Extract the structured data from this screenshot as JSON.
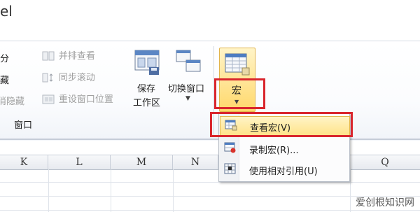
{
  "window": {
    "title_fragment": "el"
  },
  "ribbon": {
    "window_group": {
      "left_partial": [
        "分",
        "藏",
        "消隐藏"
      ],
      "items": [
        {
          "label": "并排查看",
          "enabled": false
        },
        {
          "label": "同步滚动",
          "enabled": false
        },
        {
          "label": "重设窗口位置",
          "enabled": false
        }
      ],
      "save_workspace_label_line1": "保存",
      "save_workspace_label_line2": "工作区",
      "switch_windows_label": "切换窗口",
      "group_label": "窗口"
    },
    "macros_group": {
      "label": "宏"
    }
  },
  "sheet": {
    "columns": [
      "K",
      "L",
      "M",
      "N",
      "Q"
    ]
  },
  "macro_menu": {
    "items": [
      {
        "label": "查看宏(V)",
        "icon": "view-macros-icon",
        "highlighted": true
      },
      {
        "label": "录制宏(R)...",
        "icon": "record-macro-icon",
        "highlighted": false
      },
      {
        "label": "使用相对引用(U)",
        "icon": "relative-reference-icon",
        "highlighted": false
      }
    ]
  },
  "watermark": "爱创根知识网",
  "colors": {
    "highlight": "#ffe38a",
    "annotation_red": "#d9262d",
    "ribbon_bg": "#f1f4f9"
  }
}
